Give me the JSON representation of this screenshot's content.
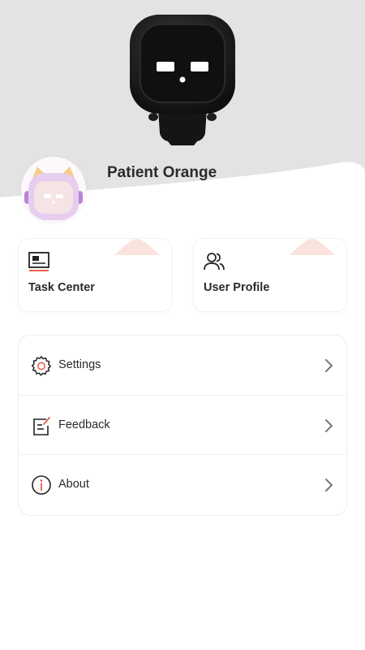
{
  "profile": {
    "username": "Patient Orange"
  },
  "quick_actions": [
    {
      "label": "Task Center",
      "icon": "task-board-icon"
    },
    {
      "label": "User Profile",
      "icon": "users-icon"
    }
  ],
  "menu": [
    {
      "label": "Settings",
      "icon": "gear-icon"
    },
    {
      "label": "Feedback",
      "icon": "feedback-edit-icon"
    },
    {
      "label": "About",
      "icon": "info-icon"
    }
  ],
  "colors": {
    "header_gray": "#e3e3e3",
    "accent_peach": "#f6c9bf",
    "accent_red": "#e8604c",
    "text_dark": "#2a2a2a"
  }
}
